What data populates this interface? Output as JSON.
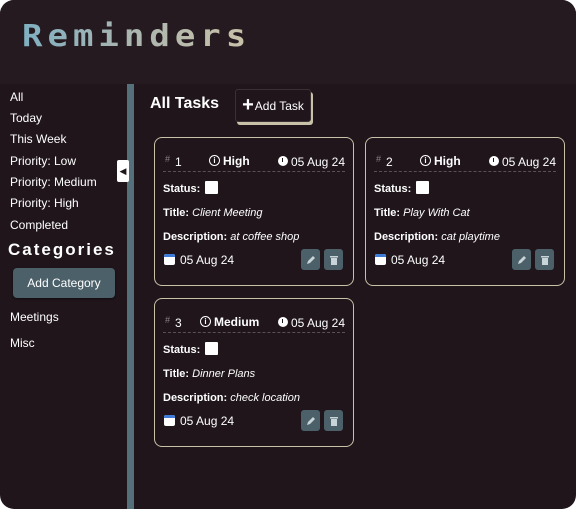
{
  "app": {
    "title": "Reminders"
  },
  "sidebar": {
    "filters": [
      "All",
      "Today",
      "This Week",
      "Priority: Low",
      "Priority: Medium",
      "Priority: High",
      "Completed"
    ],
    "categories_heading": "Categories",
    "add_category_label": "Add Category",
    "categories": [
      "Meetings",
      "Misc"
    ],
    "collapse_glyph": "◀"
  },
  "main": {
    "title": "All Tasks",
    "add_task_label": "Add Task",
    "add_task_icon": "+"
  },
  "labels": {
    "status": "Status:",
    "title": "Title:",
    "description": "Description:"
  },
  "tasks": [
    {
      "id": "1",
      "priority": "High",
      "due_date": "05 Aug 24",
      "title": "Client Meeting",
      "description": "at coffee shop",
      "created": "05 Aug 24",
      "completed": false
    },
    {
      "id": "2",
      "priority": "High",
      "due_date": "05 Aug 24",
      "title": "Play With Cat",
      "description": "cat playtime",
      "created": "05 Aug 24",
      "completed": false
    },
    {
      "id": "3",
      "priority": "Medium",
      "due_date": "05 Aug 24",
      "title": "Dinner Plans",
      "description": "check location",
      "created": "05 Aug 24",
      "completed": false
    }
  ],
  "colors": {
    "background": "#1f151b",
    "header": "#261a21",
    "accent": "#4b6068",
    "card_border": "#c9c2a8",
    "divider": "#55707a"
  }
}
